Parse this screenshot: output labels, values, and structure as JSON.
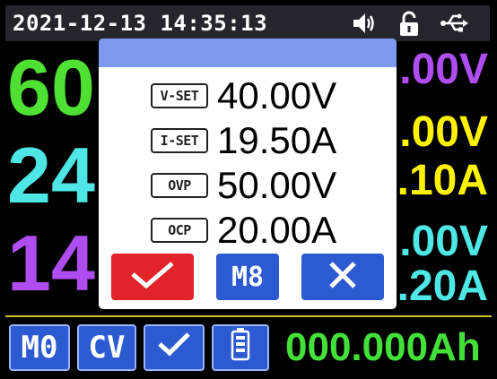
{
  "status_bar": {
    "datetime": "2021-12-13 14:35:13",
    "icons": [
      "speaker-icon",
      "unlock-icon",
      "usb-icon"
    ]
  },
  "main": {
    "voltage_set_partial": "60",
    "current_set_partial": "24",
    "power_partial": "14",
    "right_voltage_top": ".00V",
    "right_voltage_mid": ".00V",
    "right_current_mid": ".10A",
    "right_voltage_low": ".00V",
    "right_current_low": ".20A",
    "colors": {
      "green": "#4ee033",
      "cyan": "#4fe6e6",
      "purple": "#b04df2",
      "yellow": "#fff200"
    }
  },
  "bottom_bar": {
    "memory": "M0",
    "mode": "CV",
    "check_icon": "check-icon",
    "battery_icon": "battery-icon",
    "energy": "000.000Ah"
  },
  "dialog": {
    "rows": [
      {
        "tag": "V-SET",
        "value": "40.00V"
      },
      {
        "tag": "I-SET",
        "value": "19.50A"
      },
      {
        "tag": "OVP",
        "value": "50.00V"
      },
      {
        "tag": "OCP",
        "value": "20.00A"
      }
    ],
    "ok_icon": "check-icon",
    "memory_label": "M8",
    "cancel_icon": "close-icon",
    "colors": {
      "header": "#7d9af0",
      "ok": "#e2232a",
      "button": "#2c5ad0"
    }
  }
}
